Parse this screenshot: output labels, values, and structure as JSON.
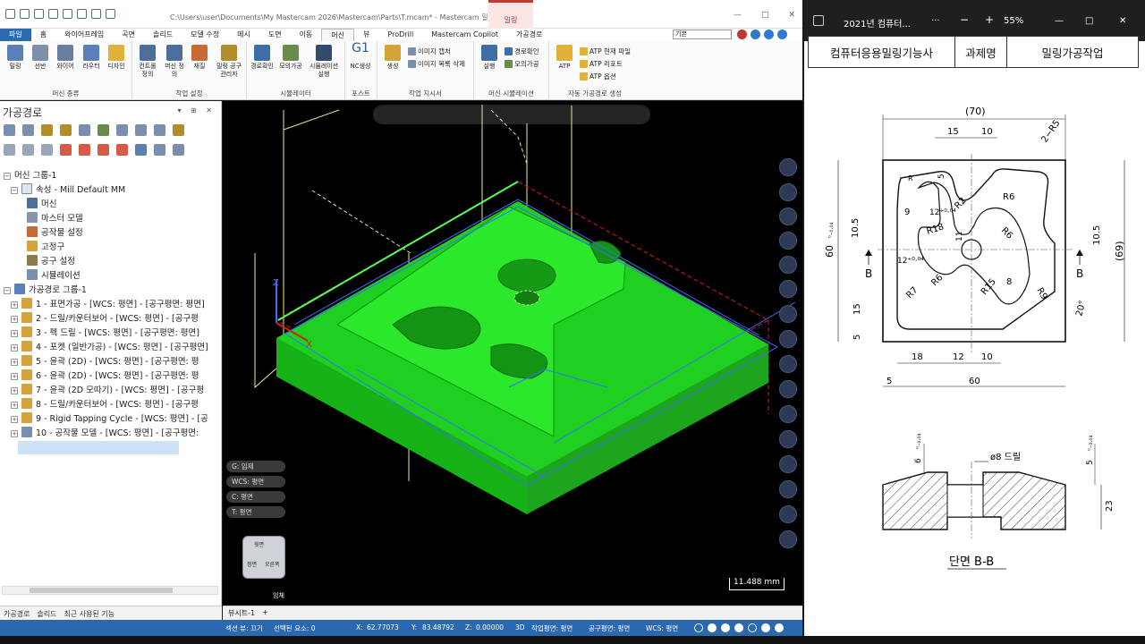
{
  "mastercam": {
    "title_path": "C:\\Users\\user\\Documents\\My Mastercam 2026\\Mastercam\\Parts\\T.mcam* - Mastercam 밀링 2026",
    "context_tab": "밀링",
    "window_controls": [
      "—",
      "□",
      "✕"
    ],
    "tabs": [
      "파일",
      "홈",
      "와이어프레임",
      "곡면",
      "솔리드",
      "모델 수정",
      "메시",
      "도면",
      "이동",
      "머신",
      "뷰",
      "ProDrill",
      "Mastercam Copilot",
      "가공경로"
    ],
    "active_tab": "머신",
    "view_combo": "기본",
    "ribbon": {
      "groups": [
        "머신 종류",
        "작업 설정",
        "시뮬레이터",
        "포스트",
        "작업 지시서",
        "머신 시뮬레이션",
        "자동 가공경로 생성"
      ],
      "machine_types": [
        "밀링",
        "선반",
        "와이어",
        "라우터",
        "디자인"
      ],
      "setup": [
        "컨트롤 정의",
        "머신 정의",
        "재질",
        "밀링 공구 관리자"
      ],
      "simulator": [
        "경로확인",
        "모의가공",
        "시뮬레이션 실행"
      ],
      "post": "NC생성",
      "post_icon": "G1",
      "worksheet": {
        "big": "생성",
        "small": [
          "이미지 캡처",
          "이미지 목록 삭제"
        ]
      },
      "machine_sim": {
        "big": "실행",
        "small": [
          "경로확인",
          "모의가공"
        ]
      },
      "atp": {
        "big": "ATP",
        "small": [
          "ATP 현재 파일",
          "ATP 리포트",
          "ATP 옵션"
        ]
      }
    },
    "panel": {
      "title": "가공경로",
      "controls": "▾ ⊞ ✕",
      "tree": {
        "machine_group": "머신 그룹-1",
        "property": "속성 - Mill Default MM",
        "property_items": [
          "머신",
          "마스터 모델",
          "공작물 설정",
          "고정구",
          "공구 설정",
          "시뮬레이션"
        ],
        "toolpath_group": "가공경로 그룹-1",
        "operations": [
          "1 - 표면가공 - [WCS: 평면] - [공구평면: 평면]",
          "2 - 드릴/카운터보어 - [WCS: 평면] - [공구평",
          "3 - 펙 드릴 - [WCS: 평면] - [공구평면: 평면]",
          "4 - 포켓 (일반가공) - [WCS: 평면] - [공구평면]",
          "5 - 윤곽 (2D) - [WCS: 평면] - [공구평면: 평",
          "6 - 윤곽 (2D) - [WCS: 평면] - [공구평면: 평",
          "7 - 윤곽 (2D 모따기) - [WCS: 평면] - [공구평",
          "8 - 드릴/카운터보어 - [WCS: 평면] - [공구평",
          "9 - Rigid Tapping Cycle - [WCS: 평면] - [공",
          "10 - 공작물 모델 - [WCS: 평면] - [공구평면:"
        ]
      },
      "bottom_tabs": [
        "가공경로",
        "솔리드",
        "최근 사용된 기능"
      ]
    },
    "viewport": {
      "pills": [
        "G: 임제",
        "WCS: 평면",
        "C: 평면",
        "T: 평면"
      ],
      "cube_label": "임체",
      "cube_faces": [
        "윗면",
        "정면",
        "오른쪽"
      ],
      "scale": "11.488 mm",
      "axis_x": "X",
      "axis_z": "Z",
      "sheet_tab": "뷰시트-1",
      "sheet_add": "+"
    },
    "status": {
      "section_view": "섹션 뷰: 끄기",
      "selected": "선택된 요소: 0",
      "x_label": "X:",
      "x": "62.77073",
      "y_label": "Y:",
      "y": "83.48792",
      "z_label": "Z:",
      "z": "0.00000",
      "mode": "3D",
      "cplane": "작업평면: 평면",
      "tplane": "공구평면: 평면",
      "wcs": "WCS: 평면"
    }
  },
  "viewer": {
    "title": "2021년 컴퓨터...",
    "more": "···",
    "zoom_out": "−",
    "zoom_in": "+",
    "zoom": "55%",
    "header": [
      "컴퓨터응용밀링기능사",
      "과제명",
      "밀링가공작업"
    ],
    "dims": {
      "top70": "(70)",
      "d15": "15",
      "d10": "10",
      "r25": "2−R5",
      "r": "R",
      "d5a": "5",
      "r6a": "R6",
      "r2": "R2",
      "r6b": "R6",
      "d9": "9",
      "d12a": "12⁺⁰·⁰⁴",
      "d12b": "12⁺⁰·⁰⁴",
      "r18": "R18",
      "d11": "11",
      "d105l": "10.5",
      "d105r": "10.5",
      "d60l": "60",
      "tol60": "⁰₋₀.₀₄",
      "d69": "(69)",
      "b_l": "B",
      "b_r": "B",
      "r7": "R7",
      "r6c": "R6",
      "r15": "R15",
      "d8": "8",
      "r9": "R9",
      "d15l": "15",
      "d5l": "5",
      "a20": "20°",
      "b18": "18",
      "b12": "12",
      "b10": "10",
      "b5": "5",
      "b60": "60",
      "hole": "ø8 드릴",
      "d6": "6",
      "d5s": "5",
      "tol6": "⁰₋₀.₀₄",
      "tol5": "⁰₋₀.₀₄",
      "d23": "23",
      "section": "단면 B-B"
    }
  },
  "colors": {
    "accent": "#2b68b0",
    "part_green": "#19c918",
    "viewport_bg": "#000000",
    "context_red": "#c23a31"
  }
}
